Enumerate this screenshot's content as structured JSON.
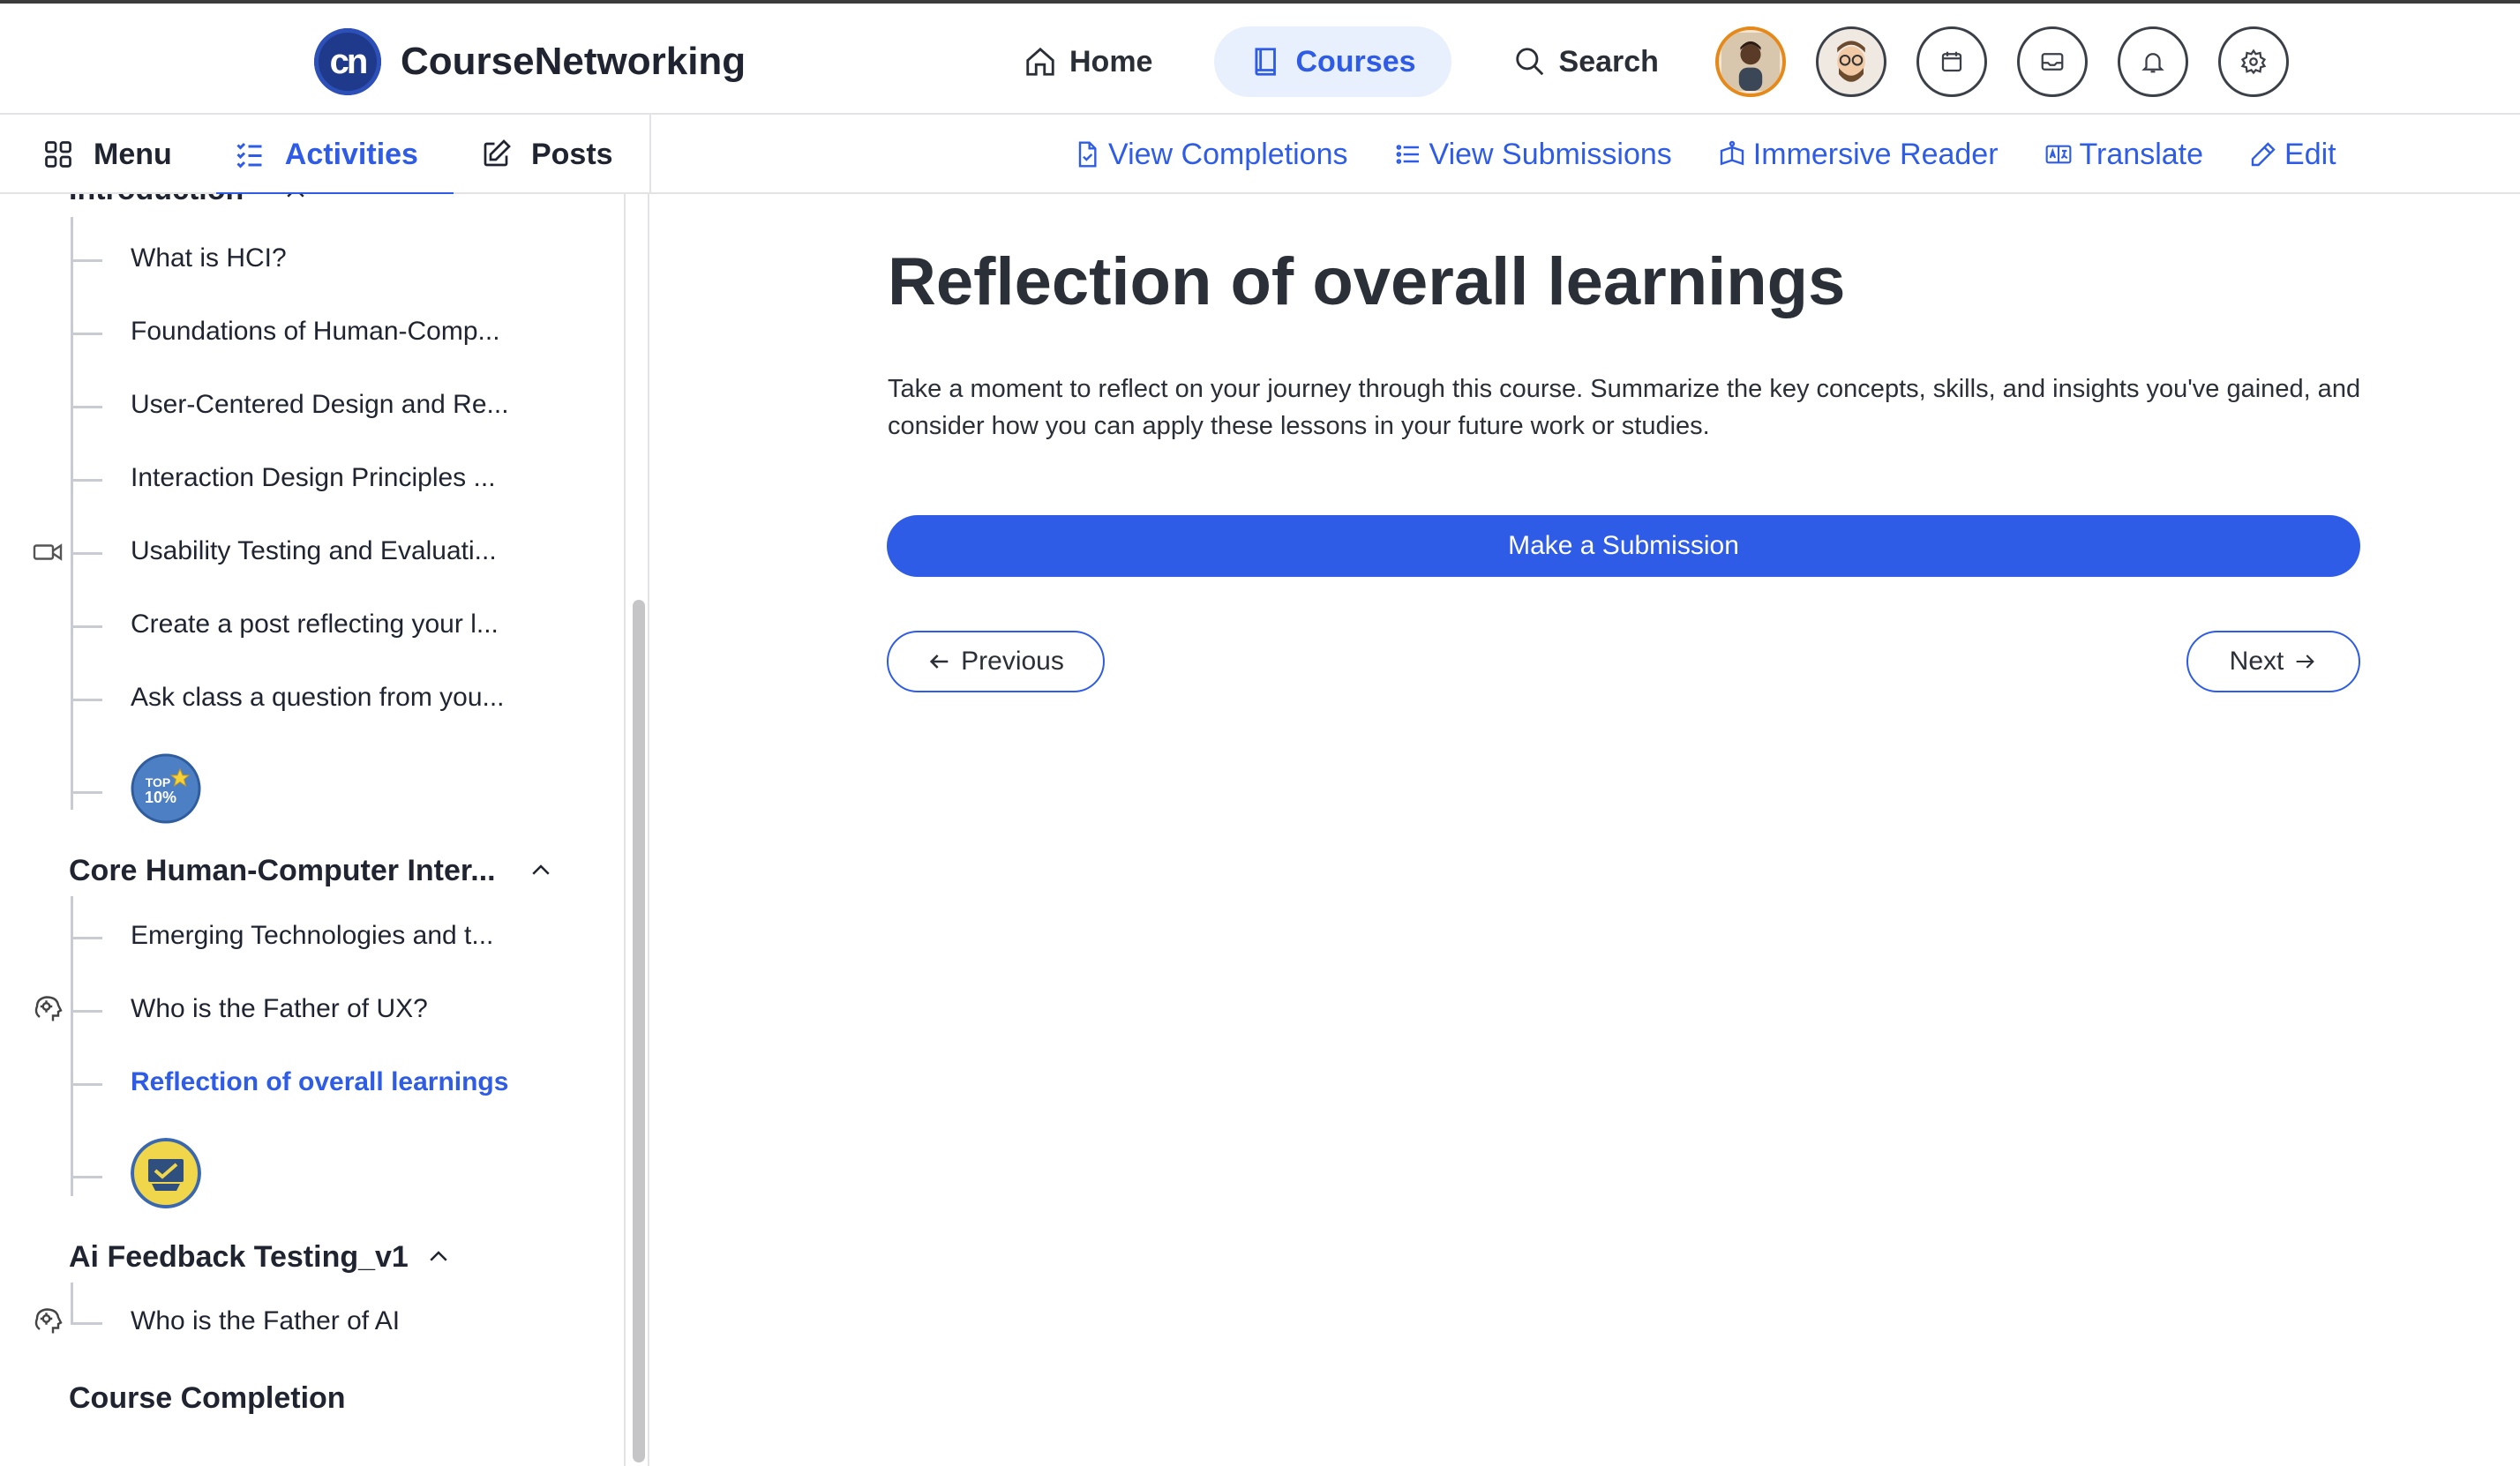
{
  "brand": {
    "logo_text": "cn",
    "name": "CourseNetworking"
  },
  "nav": {
    "home": "Home",
    "courses": "Courses",
    "search": "Search"
  },
  "top_icons": [
    "user-avatar",
    "profile-avatar",
    "calendar-icon",
    "mail-icon",
    "bell-icon",
    "gear-icon"
  ],
  "tabs": {
    "menu": "Menu",
    "activities": "Activities",
    "posts": "Posts"
  },
  "actions": {
    "view_completions": "View Completions",
    "view_submissions": "View Submissions",
    "immersive_reader": "Immersive Reader",
    "translate": "Translate",
    "edit": "Edit"
  },
  "sidebar": {
    "sections": [
      {
        "title": "Introduction",
        "items": [
          "What is HCI?",
          "Foundations of Human-Comp...",
          "User-Centered Design and Re...",
          "Interaction Design Principles ...",
          "Usability Testing and Evaluati...",
          "Create a post reflecting your l...",
          "Ask class a question from you..."
        ],
        "badge_text": "TOP 10%"
      },
      {
        "title": "Core Human-Computer Inter...",
        "items": [
          "Emerging Technologies and t...",
          "Who is the Father of UX?",
          "Reflection of overall learnings"
        ]
      },
      {
        "title": "Ai Feedback Testing_v1",
        "items": [
          "Who is the Father of AI"
        ]
      },
      {
        "title": "Course Completion"
      }
    ]
  },
  "main": {
    "title": "Reflection of overall learnings",
    "description": "Take a moment to reflect on your journey through this course. Summarize the key concepts, skills, and insights you've gained, and consider how you can apply these lessons in your future work or studies.",
    "submit_label": "Make a Submission",
    "previous_label": "Previous",
    "next_label": "Next"
  },
  "colors": {
    "accent": "#2e5ce6",
    "accent_light": "#e8effd",
    "text": "#1f2430",
    "border": "#e3e3e6"
  }
}
